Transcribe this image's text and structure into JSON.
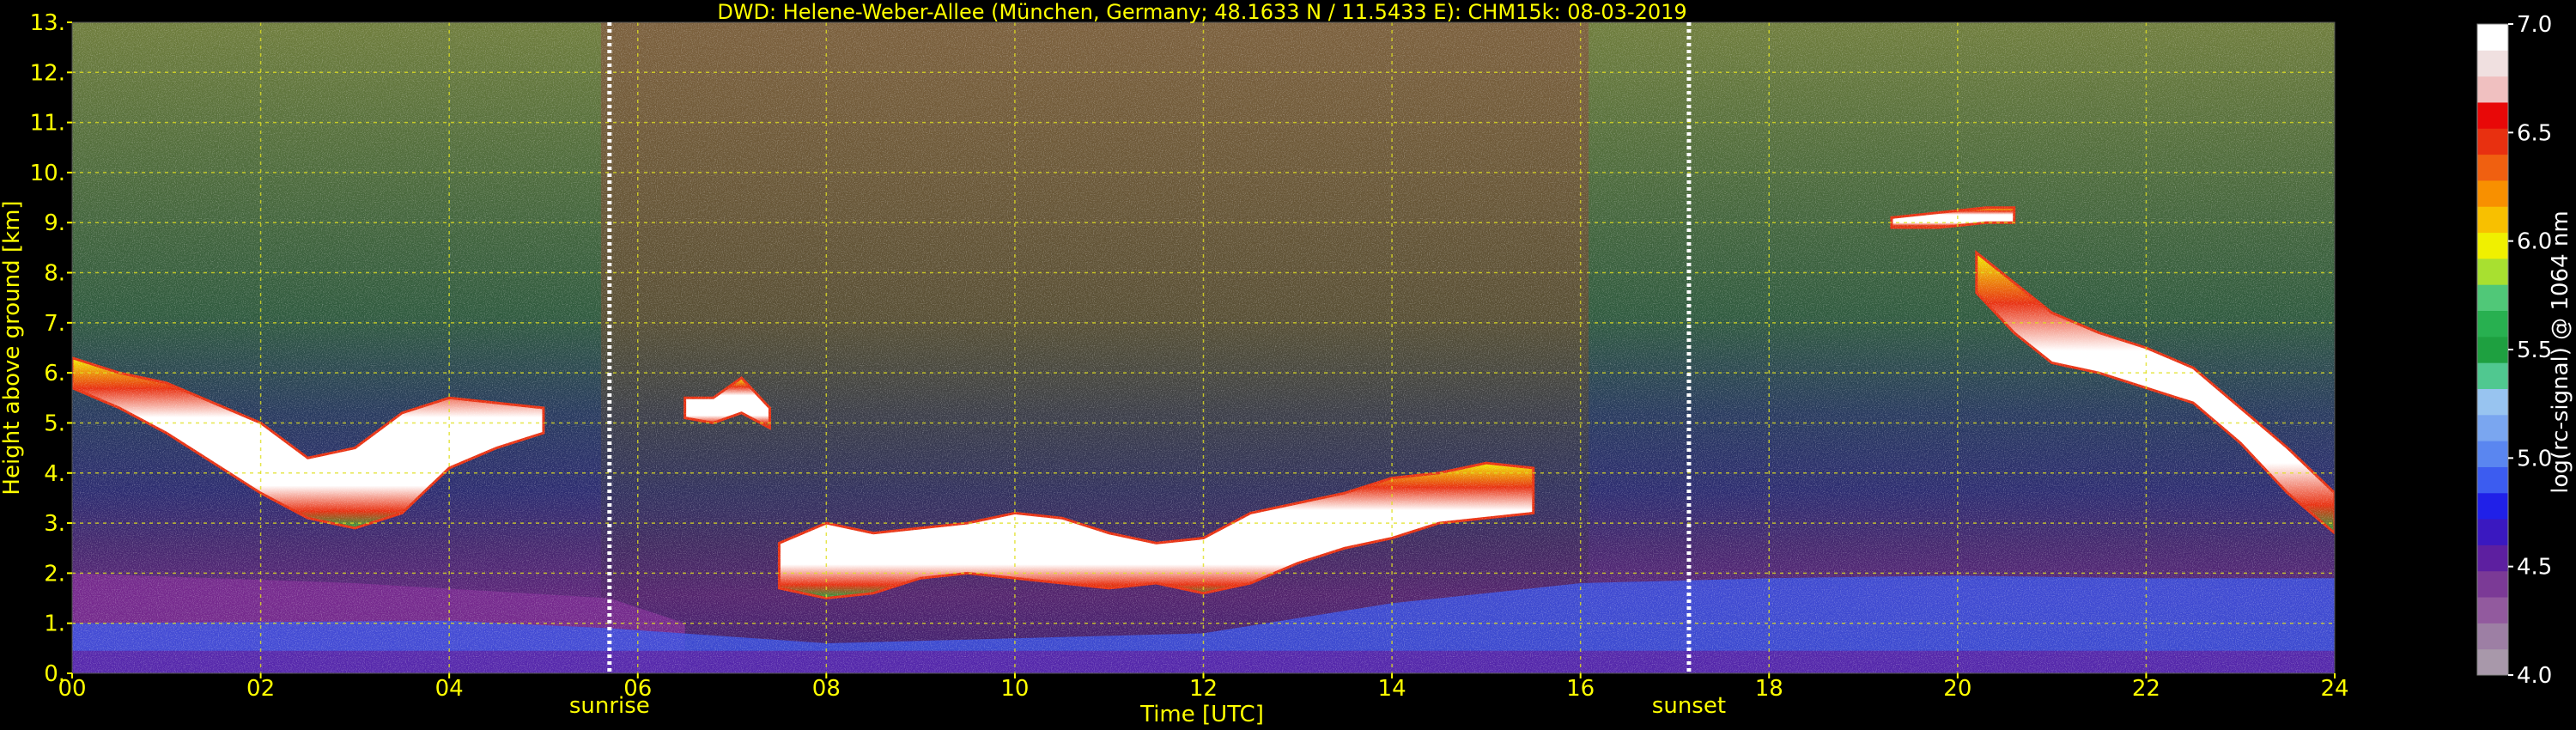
{
  "chart_data": {
    "type": "heatmap",
    "title": "DWD: Helene-Weber-Allee (München, Germany; 48.1633 N / 11.5433 E):    CHM15k: 08-03-2019",
    "xlabel": "Time [UTC]",
    "ylabel": "Height above ground [km]",
    "xlim": [
      0,
      24
    ],
    "ylim": [
      0,
      13
    ],
    "x_ticks": [
      0,
      2,
      4,
      6,
      8,
      10,
      12,
      14,
      16,
      18,
      20,
      22,
      24
    ],
    "x_tick_labels": [
      "00",
      "02",
      "04",
      "06",
      "08",
      "10",
      "12",
      "14",
      "16",
      "18",
      "20",
      "22",
      "24"
    ],
    "y_ticks": [
      0,
      1,
      2,
      3,
      4,
      5,
      6,
      7,
      8,
      9,
      10,
      11,
      12,
      13
    ],
    "y_tick_labels": [
      "0.",
      "1.",
      "2.",
      "3.",
      "4.",
      "5.",
      "6.",
      "7.",
      "8.",
      "9.",
      "10.",
      "11.",
      "12.",
      "13."
    ],
    "grid": true,
    "events": [
      {
        "label": "sunrise",
        "x": 5.7
      },
      {
        "label": "sunset",
        "x": 17.15
      }
    ],
    "colorbar": {
      "label": "log(rc-signal) @ 1064 nm",
      "min": 4.0,
      "max": 7.0,
      "ticks": [
        4.0,
        4.5,
        5.0,
        5.5,
        6.0,
        6.5,
        7.0
      ],
      "tick_labels": [
        "4.0",
        "4.5",
        "5.0",
        "5.5",
        "6.0",
        "6.5",
        "7.0"
      ],
      "colors": [
        "#a898aa",
        "#9d7fa4",
        "#925a9e",
        "#7b3a96",
        "#5d1fa0",
        "#3a18c0",
        "#2020e8",
        "#3c5cf0",
        "#5a86f0",
        "#7aa6f0",
        "#98c4f0",
        "#50c890",
        "#1ea040",
        "#28b050",
        "#50c878",
        "#a8e030",
        "#f0f000",
        "#f8c000",
        "#f89000",
        "#f06010",
        "#e83010",
        "#e80808",
        "#f0c0c0",
        "#f0e0e0",
        "#ffffff"
      ]
    },
    "layers": {
      "surface_aerosol_blue": [
        {
          "x": 0,
          "top": 1.0
        },
        {
          "x": 4,
          "top": 1.05
        },
        {
          "x": 5.7,
          "top": 0.9
        },
        {
          "x": 8,
          "top": 0.6
        },
        {
          "x": 12,
          "top": 0.8
        },
        {
          "x": 14,
          "top": 1.4
        },
        {
          "x": 16,
          "top": 1.8
        },
        {
          "x": 18,
          "top": 1.9
        },
        {
          "x": 20,
          "top": 1.95
        },
        {
          "x": 22,
          "top": 1.9
        },
        {
          "x": 24,
          "top": 1.9
        }
      ],
      "surface_aerosol_purple": [
        {
          "x": 0,
          "top": 2.0
        },
        {
          "x": 3,
          "top": 1.8
        },
        {
          "x": 5.7,
          "top": 1.5
        },
        {
          "x": 6.5,
          "top": 1.0
        }
      ],
      "cloud_layers": [
        {
          "x": [
            0,
            0.5,
            1,
            1.5,
            2,
            2.5,
            3,
            3.5,
            4,
            4.5,
            5
          ],
          "bottom": [
            5.7,
            5.3,
            4.8,
            4.2,
            3.6,
            3.1,
            2.9,
            3.2,
            4.1,
            4.5,
            4.8
          ],
          "top": [
            6.3,
            6.0,
            5.8,
            5.4,
            5.0,
            4.3,
            4.5,
            5.2,
            5.5,
            5.4,
            5.3
          ]
        },
        {
          "x": [
            6.5,
            6.8,
            7.1,
            7.4
          ],
          "bottom": [
            5.1,
            5.0,
            5.2,
            4.9
          ],
          "top": [
            5.5,
            5.5,
            5.9,
            5.3
          ]
        },
        {
          "x": [
            7.5,
            8.0,
            8.5,
            9.0,
            9.5,
            10.0,
            10.5,
            11.0,
            11.5,
            12.0,
            12.5,
            13.0,
            13.5,
            14.0,
            14.5,
            15.0,
            15.5
          ],
          "bottom": [
            1.7,
            1.5,
            1.6,
            1.9,
            2.0,
            1.9,
            1.8,
            1.7,
            1.8,
            1.6,
            1.8,
            2.2,
            2.5,
            2.7,
            3.0,
            3.1,
            3.2
          ],
          "top": [
            2.6,
            3.0,
            2.8,
            2.9,
            3.0,
            3.2,
            3.1,
            2.8,
            2.6,
            2.7,
            3.2,
            3.4,
            3.6,
            3.9,
            4.0,
            4.2,
            4.1
          ]
        },
        {
          "x": [
            19.3,
            19.8,
            20.3,
            20.6
          ],
          "bottom": [
            8.9,
            8.9,
            9.0,
            9.0
          ],
          "top": [
            9.1,
            9.2,
            9.3,
            9.3
          ]
        },
        {
          "x": [
            20.2,
            20.6,
            21.0,
            21.5,
            22.0,
            22.5,
            23.0,
            23.5,
            24.0
          ],
          "bottom": [
            7.6,
            6.8,
            6.2,
            6.0,
            5.7,
            5.4,
            4.6,
            3.6,
            2.8
          ],
          "top": [
            8.4,
            7.8,
            7.2,
            6.8,
            6.5,
            6.1,
            5.3,
            4.5,
            3.6
          ]
        }
      ]
    }
  }
}
